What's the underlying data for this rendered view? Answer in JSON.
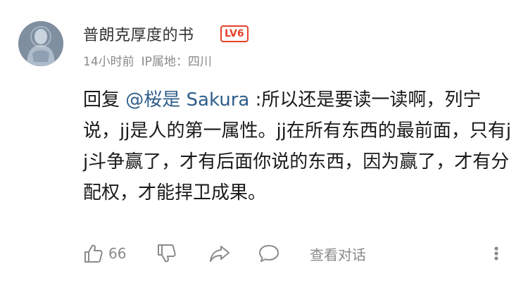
{
  "comment": {
    "username": "普朗克厚度的书",
    "level": "LV6",
    "time": "14小时前",
    "ip_location": "IP属地：四川",
    "reply_prefix": "回复 ",
    "mention": "@桜是 Sakura",
    "body": " :所以还是要读一读啊，列宁说，jj是人的第一属性。jj在所有东西的最前面，只有jj斗争赢了，才有后面你说的东西，因为赢了，才有分配权，才能捍卫成果。",
    "like_count": "66",
    "view_thread_label": "查看对话"
  },
  "icons": {
    "avatar": "avatar-figure",
    "like": "thumbs-up-icon",
    "dislike": "thumbs-down-icon",
    "share": "share-arrow-icon",
    "reply": "speech-bubble-icon",
    "more": "vertical-dots-icon"
  },
  "colors": {
    "mention": "#2f5d8a",
    "level_badge": "#e8412b",
    "meta_text": "#8a8a8a"
  }
}
